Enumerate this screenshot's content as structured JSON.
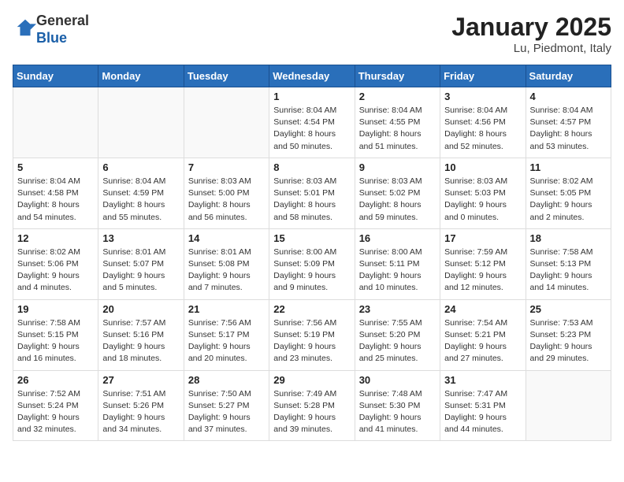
{
  "header": {
    "logo_line1": "General",
    "logo_line2": "Blue",
    "month": "January 2025",
    "location": "Lu, Piedmont, Italy"
  },
  "weekdays": [
    "Sunday",
    "Monday",
    "Tuesday",
    "Wednesday",
    "Thursday",
    "Friday",
    "Saturday"
  ],
  "weeks": [
    [
      {
        "day": "",
        "info": ""
      },
      {
        "day": "",
        "info": ""
      },
      {
        "day": "",
        "info": ""
      },
      {
        "day": "1",
        "info": "Sunrise: 8:04 AM\nSunset: 4:54 PM\nDaylight: 8 hours\nand 50 minutes."
      },
      {
        "day": "2",
        "info": "Sunrise: 8:04 AM\nSunset: 4:55 PM\nDaylight: 8 hours\nand 51 minutes."
      },
      {
        "day": "3",
        "info": "Sunrise: 8:04 AM\nSunset: 4:56 PM\nDaylight: 8 hours\nand 52 minutes."
      },
      {
        "day": "4",
        "info": "Sunrise: 8:04 AM\nSunset: 4:57 PM\nDaylight: 8 hours\nand 53 minutes."
      }
    ],
    [
      {
        "day": "5",
        "info": "Sunrise: 8:04 AM\nSunset: 4:58 PM\nDaylight: 8 hours\nand 54 minutes."
      },
      {
        "day": "6",
        "info": "Sunrise: 8:04 AM\nSunset: 4:59 PM\nDaylight: 8 hours\nand 55 minutes."
      },
      {
        "day": "7",
        "info": "Sunrise: 8:03 AM\nSunset: 5:00 PM\nDaylight: 8 hours\nand 56 minutes."
      },
      {
        "day": "8",
        "info": "Sunrise: 8:03 AM\nSunset: 5:01 PM\nDaylight: 8 hours\nand 58 minutes."
      },
      {
        "day": "9",
        "info": "Sunrise: 8:03 AM\nSunset: 5:02 PM\nDaylight: 8 hours\nand 59 minutes."
      },
      {
        "day": "10",
        "info": "Sunrise: 8:03 AM\nSunset: 5:03 PM\nDaylight: 9 hours\nand 0 minutes."
      },
      {
        "day": "11",
        "info": "Sunrise: 8:02 AM\nSunset: 5:05 PM\nDaylight: 9 hours\nand 2 minutes."
      }
    ],
    [
      {
        "day": "12",
        "info": "Sunrise: 8:02 AM\nSunset: 5:06 PM\nDaylight: 9 hours\nand 4 minutes."
      },
      {
        "day": "13",
        "info": "Sunrise: 8:01 AM\nSunset: 5:07 PM\nDaylight: 9 hours\nand 5 minutes."
      },
      {
        "day": "14",
        "info": "Sunrise: 8:01 AM\nSunset: 5:08 PM\nDaylight: 9 hours\nand 7 minutes."
      },
      {
        "day": "15",
        "info": "Sunrise: 8:00 AM\nSunset: 5:09 PM\nDaylight: 9 hours\nand 9 minutes."
      },
      {
        "day": "16",
        "info": "Sunrise: 8:00 AM\nSunset: 5:11 PM\nDaylight: 9 hours\nand 10 minutes."
      },
      {
        "day": "17",
        "info": "Sunrise: 7:59 AM\nSunset: 5:12 PM\nDaylight: 9 hours\nand 12 minutes."
      },
      {
        "day": "18",
        "info": "Sunrise: 7:58 AM\nSunset: 5:13 PM\nDaylight: 9 hours\nand 14 minutes."
      }
    ],
    [
      {
        "day": "19",
        "info": "Sunrise: 7:58 AM\nSunset: 5:15 PM\nDaylight: 9 hours\nand 16 minutes."
      },
      {
        "day": "20",
        "info": "Sunrise: 7:57 AM\nSunset: 5:16 PM\nDaylight: 9 hours\nand 18 minutes."
      },
      {
        "day": "21",
        "info": "Sunrise: 7:56 AM\nSunset: 5:17 PM\nDaylight: 9 hours\nand 20 minutes."
      },
      {
        "day": "22",
        "info": "Sunrise: 7:56 AM\nSunset: 5:19 PM\nDaylight: 9 hours\nand 23 minutes."
      },
      {
        "day": "23",
        "info": "Sunrise: 7:55 AM\nSunset: 5:20 PM\nDaylight: 9 hours\nand 25 minutes."
      },
      {
        "day": "24",
        "info": "Sunrise: 7:54 AM\nSunset: 5:21 PM\nDaylight: 9 hours\nand 27 minutes."
      },
      {
        "day": "25",
        "info": "Sunrise: 7:53 AM\nSunset: 5:23 PM\nDaylight: 9 hours\nand 29 minutes."
      }
    ],
    [
      {
        "day": "26",
        "info": "Sunrise: 7:52 AM\nSunset: 5:24 PM\nDaylight: 9 hours\nand 32 minutes."
      },
      {
        "day": "27",
        "info": "Sunrise: 7:51 AM\nSunset: 5:26 PM\nDaylight: 9 hours\nand 34 minutes."
      },
      {
        "day": "28",
        "info": "Sunrise: 7:50 AM\nSunset: 5:27 PM\nDaylight: 9 hours\nand 37 minutes."
      },
      {
        "day": "29",
        "info": "Sunrise: 7:49 AM\nSunset: 5:28 PM\nDaylight: 9 hours\nand 39 minutes."
      },
      {
        "day": "30",
        "info": "Sunrise: 7:48 AM\nSunset: 5:30 PM\nDaylight: 9 hours\nand 41 minutes."
      },
      {
        "day": "31",
        "info": "Sunrise: 7:47 AM\nSunset: 5:31 PM\nDaylight: 9 hours\nand 44 minutes."
      },
      {
        "day": "",
        "info": ""
      }
    ]
  ]
}
